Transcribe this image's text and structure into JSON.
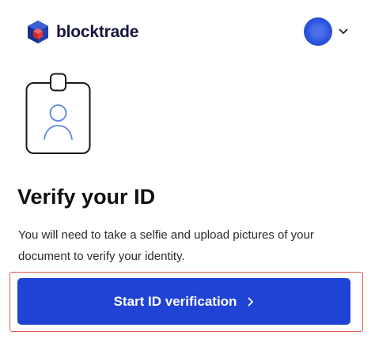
{
  "brand": {
    "name": "blocktrade",
    "logo_icon": "cube-logo-icon",
    "logo_color": "#1f3fae",
    "logo_accent": "#e5393b"
  },
  "account_menu": {
    "avatar_icon": "user-avatar",
    "chevron_icon": "chevron-down-icon"
  },
  "illustration": {
    "icon": "id-badge-icon"
  },
  "main": {
    "title": "Verify your ID",
    "description": "You will need to take a selfie and upload pictures of your document to verify your identity."
  },
  "cta": {
    "label": "Start ID verification",
    "icon": "chevron-right-icon",
    "color": "#2043d6",
    "highlight_color": "#e05a4e"
  }
}
